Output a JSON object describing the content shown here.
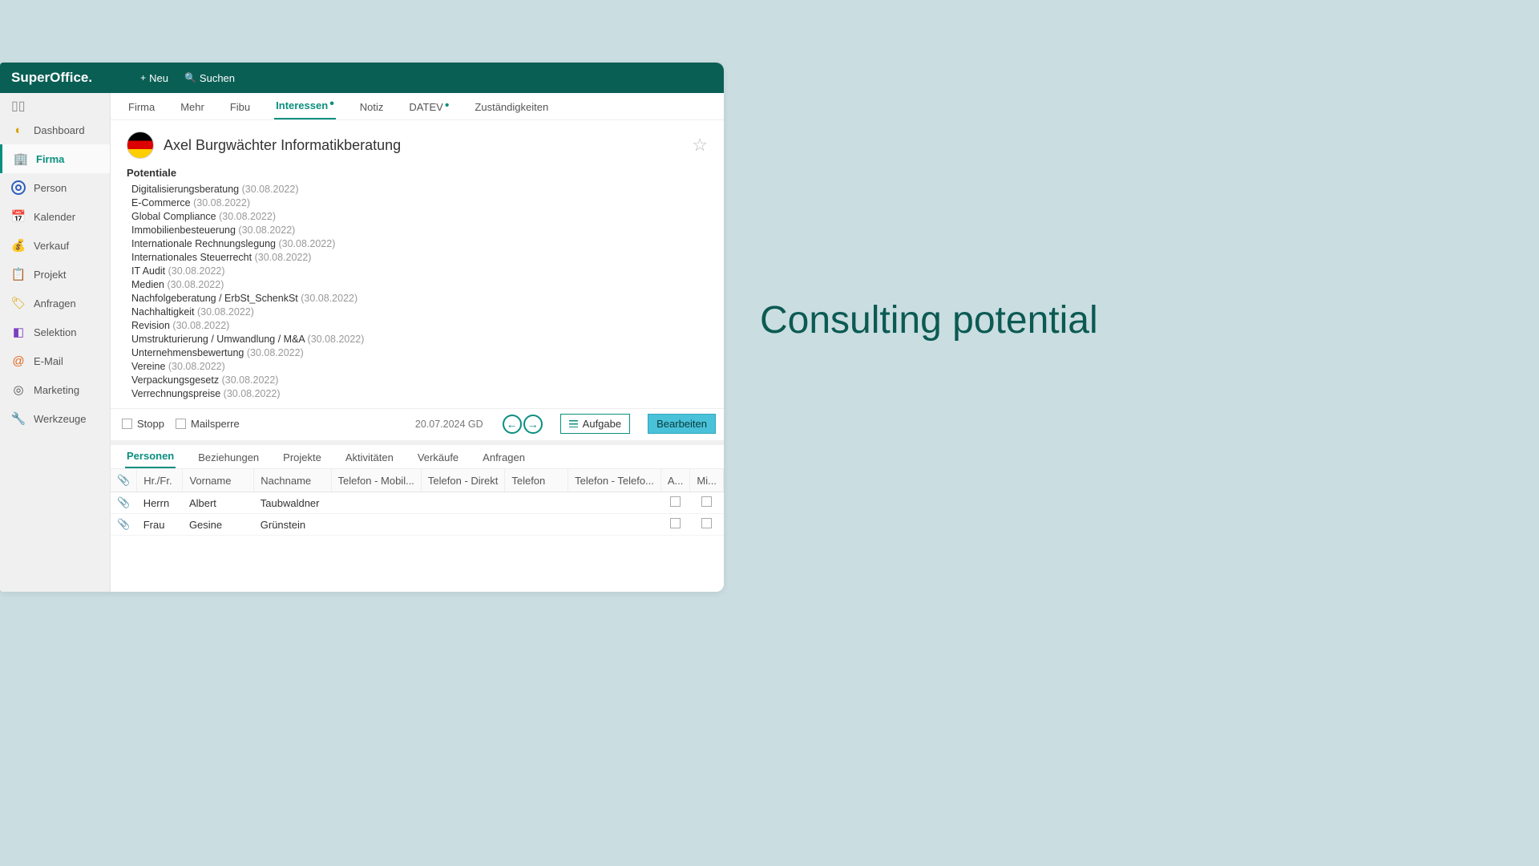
{
  "slide_title": "Consulting potential",
  "brand": "SuperOffice.",
  "header": {
    "new": "Neu",
    "search": "Suchen"
  },
  "sidebar": [
    {
      "label": "Dashboard",
      "icon": "gauge-icon"
    },
    {
      "label": "Firma",
      "icon": "building-icon",
      "active": true
    },
    {
      "label": "Person",
      "icon": "person-icon"
    },
    {
      "label": "Kalender",
      "icon": "calendar-icon"
    },
    {
      "label": "Verkauf",
      "icon": "coin-icon"
    },
    {
      "label": "Projekt",
      "icon": "clipboard-icon"
    },
    {
      "label": "Anfragen",
      "icon": "ticket-icon"
    },
    {
      "label": "Selektion",
      "icon": "selection-icon"
    },
    {
      "label": "E-Mail",
      "icon": "at-icon"
    },
    {
      "label": "Marketing",
      "icon": "target-icon"
    },
    {
      "label": "Werkzeuge",
      "icon": "wrench-icon"
    }
  ],
  "tabs_top": [
    {
      "label": "Firma"
    },
    {
      "label": "Mehr"
    },
    {
      "label": "Fibu"
    },
    {
      "label": "Interessen",
      "active": true,
      "dot": true
    },
    {
      "label": "Notiz"
    },
    {
      "label": "DATEV",
      "dot": true
    },
    {
      "label": "Zuständigkeiten"
    }
  ],
  "company": {
    "name": "Axel Burgwächter Informatikberatung",
    "potentials_title": "Potentiale",
    "potentials": [
      {
        "name": "Digitalisierungsberatung",
        "date": "(30.08.2022)"
      },
      {
        "name": "E-Commerce",
        "date": "(30.08.2022)"
      },
      {
        "name": "Global Compliance",
        "date": "(30.08.2022)"
      },
      {
        "name": "Immobilienbesteuerung",
        "date": "(30.08.2022)"
      },
      {
        "name": "Internationale Rechnungslegung",
        "date": "(30.08.2022)"
      },
      {
        "name": "Internationales Steuerrecht",
        "date": "(30.08.2022)"
      },
      {
        "name": "IT Audit",
        "date": "(30.08.2022)"
      },
      {
        "name": "Medien",
        "date": "(30.08.2022)"
      },
      {
        "name": "Nachfolgeberatung / ErbSt_SchenkSt",
        "date": "(30.08.2022)"
      },
      {
        "name": "Nachhaltigkeit",
        "date": "(30.08.2022)"
      },
      {
        "name": "Revision",
        "date": "(30.08.2022)"
      },
      {
        "name": "Umstrukturierung / Umwandlung / M&A",
        "date": "(30.08.2022)"
      },
      {
        "name": "Unternehmensbewertung",
        "date": "(30.08.2022)"
      },
      {
        "name": "Vereine",
        "date": "(30.08.2022)"
      },
      {
        "name": "Verpackungsgesetz",
        "date": "(30.08.2022)"
      },
      {
        "name": "Verrechnungspreise",
        "date": "(30.08.2022)"
      }
    ]
  },
  "footer": {
    "stopp": "Stopp",
    "mailsperre": "Mailsperre",
    "date": "20.07.2024 GD",
    "aufgabe": "Aufgabe",
    "bearbeiten": "Bearbeiten"
  },
  "tabs_bottom": [
    {
      "label": "Personen",
      "active": true
    },
    {
      "label": "Beziehungen"
    },
    {
      "label": "Projekte"
    },
    {
      "label": "Aktivitäten"
    },
    {
      "label": "Verkäufe"
    },
    {
      "label": "Anfragen"
    }
  ],
  "persons": {
    "cols": [
      "",
      "Hr./Fr.",
      "Vorname",
      "Nachname",
      "Telefon - Mobil...",
      "Telefon - Direkt",
      "Telefon",
      "Telefon - Telefo...",
      "A...",
      "Mi..."
    ],
    "rows": [
      {
        "title": "Herrn",
        "first": "Albert",
        "last": "Taubwaldner"
      },
      {
        "title": "Frau",
        "first": "Gesine",
        "last": "Grünstein"
      }
    ]
  }
}
